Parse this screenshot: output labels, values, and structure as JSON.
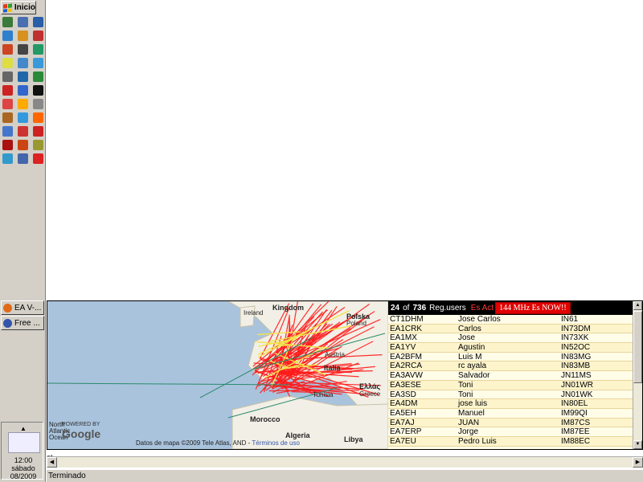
{
  "taskbar": {
    "start_label": "Inicio",
    "quick_launch_colors": [
      "#3a7a3a",
      "#4a6fb0",
      "#2a5ea8",
      "#2f7fcf",
      "#d89020",
      "#c03030",
      "#cc4422",
      "#444444",
      "#229966",
      "#dddd44",
      "#4488cc",
      "#3a9ad9",
      "#666666",
      "#2266aa",
      "#2a8a3a",
      "#cc2222",
      "#3366cc",
      "#111111",
      "#dd4444",
      "#ffaa00",
      "#888888",
      "#aa6622",
      "#3399dd",
      "#ff6600",
      "#4477cc",
      "#cc3333",
      "#cc2222",
      "#aa1111",
      "#cc4411",
      "#999933",
      "#3399cc",
      "#4466aa",
      "#dd2222"
    ],
    "tasks": [
      {
        "label": "EA V-...",
        "icon_color": "#e06a1a"
      },
      {
        "label": "Free ...",
        "icon_color": "#3355aa"
      }
    ],
    "clock_lines": [
      "12:00",
      "sábado",
      "08/2009"
    ]
  },
  "map": {
    "labels": [
      {
        "text": "Ireland",
        "bold": false
      },
      {
        "text": "Kingdom",
        "bold": true
      },
      {
        "text": "Polska",
        "bold": true
      },
      {
        "text": "Poland",
        "bold": false
      },
      {
        "text": "Austria",
        "bold": false
      },
      {
        "text": "Italia",
        "bold": true
      },
      {
        "text": "Ελλάς",
        "bold": true
      },
      {
        "text": "Greece",
        "bold": false
      },
      {
        "text": "Morocco",
        "bold": true
      },
      {
        "text": "Algeria",
        "bold": true
      },
      {
        "text": "Libya",
        "bold": true
      },
      {
        "text": "Tunisia",
        "bold": false
      }
    ],
    "credit_text": "Datos de mapa ©2009 Tele Atlas, AND - ",
    "credit_link": "Términos de uso",
    "logo_small": "POWERED BY",
    "logo_text": "Google",
    "ocean_label": "North Atlantic Ocean"
  },
  "users": {
    "online_count": "24",
    "of_label": "of",
    "total_count": "736",
    "reg_label": "Reg.users",
    "es_label": "Es Act",
    "alert_label": "144 MHz Es NOW!!",
    "rows": [
      {
        "call": "CT1DHM",
        "name": "Jose Carlos",
        "locator": "IN61"
      },
      {
        "call": "EA1CRK",
        "name": "Carlos",
        "locator": "IN73DM"
      },
      {
        "call": "EA1MX",
        "name": "Jose",
        "locator": "IN73XK"
      },
      {
        "call": "EA1YV",
        "name": "Agustin",
        "locator": "IN52OC"
      },
      {
        "call": "EA2BFM",
        "name": "Luis M",
        "locator": "IN83MG"
      },
      {
        "call": "EA2RCA",
        "name": "rc ayala",
        "locator": "IN83MB"
      },
      {
        "call": "EA3AVW",
        "name": "Salvador",
        "locator": "JN11MS"
      },
      {
        "call": "EA3ESE",
        "name": "Toni",
        "locator": "JN01WR"
      },
      {
        "call": "EA3SD",
        "name": "Toni",
        "locator": "JN01WK"
      },
      {
        "call": "EA4DM",
        "name": "jose luis",
        "locator": "IN80EL"
      },
      {
        "call": "EA5EH",
        "name": "Manuel",
        "locator": "IM99QI"
      },
      {
        "call": "EA7AJ",
        "name": "JUAN",
        "locator": "IM87CS"
      },
      {
        "call": "EA7ERP",
        "name": "Jorge",
        "locator": "IM87EE"
      },
      {
        "call": "EA7EU",
        "name": "Pedro Luis",
        "locator": "IM88EC"
      }
    ]
  },
  "statusbar": {
    "text": "Terminado",
    "fragment": "et"
  },
  "colors": {
    "path_red": "#ff1a1a",
    "path_yellow": "#f2e24a",
    "path_green": "#2a8a6a",
    "sea": "#a9c3dd",
    "land": "#f2efe6"
  }
}
